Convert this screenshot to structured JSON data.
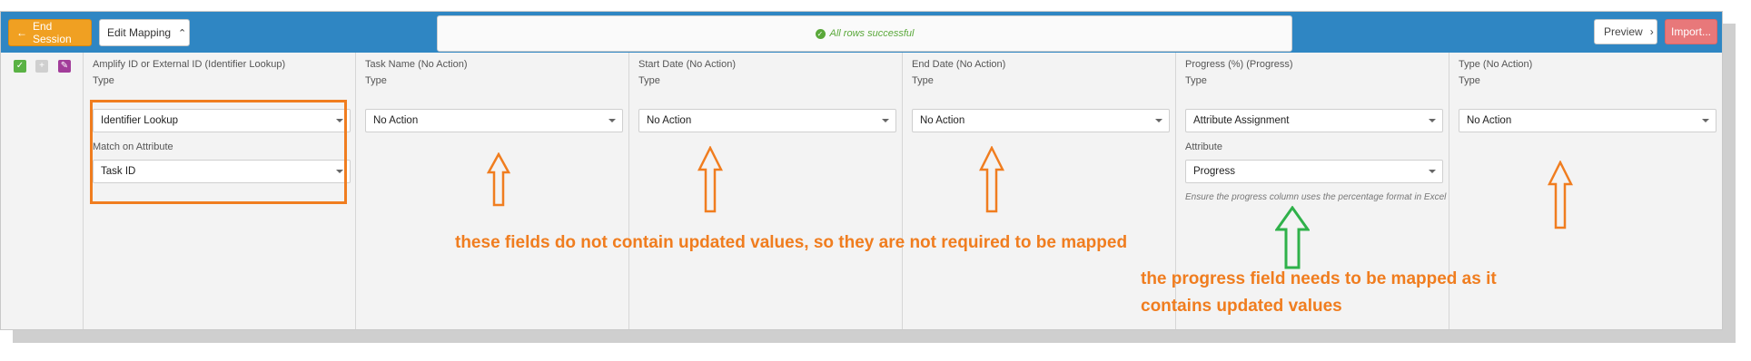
{
  "toolbar": {
    "end_session": "End Session",
    "edit_mapping": "Edit Mapping",
    "status": "All rows successful",
    "preview": "Preview",
    "import": "Import..."
  },
  "columns": [
    {
      "header": "Amplify ID or External ID (Identifier Lookup)",
      "type_label": "Type",
      "type_value": "Identifier Lookup",
      "match_label": "Match on Attribute",
      "match_value": "Task ID"
    },
    {
      "header": "Task Name (No Action)",
      "type_label": "Type",
      "type_value": "No Action"
    },
    {
      "header": "Start Date (No Action)",
      "type_label": "Type",
      "type_value": "No Action"
    },
    {
      "header": "End Date (No Action)",
      "type_label": "Type",
      "type_value": "No Action"
    },
    {
      "header": "Progress (%) (Progress)",
      "type_label": "Type",
      "type_value": "Attribute Assignment",
      "attr_label": "Attribute",
      "attr_value": "Progress",
      "hint": "Ensure the progress column uses the percentage format in Excel"
    },
    {
      "header": "Type (No Action)",
      "type_label": "Type",
      "type_value": "No Action"
    }
  ],
  "annotations": {
    "no_action_note": "these fields do not contain updated values, so they are not required to be mapped",
    "progress_note": "the progress field needs to be mapped as it contains updated values"
  },
  "colors": {
    "toolbar": "#2f86c3",
    "end_session": "#f0a022",
    "import": "#e8787a",
    "annotation_orange": "#f07d1f",
    "annotation_green": "#2fb14a",
    "success": "#5aa83a"
  }
}
